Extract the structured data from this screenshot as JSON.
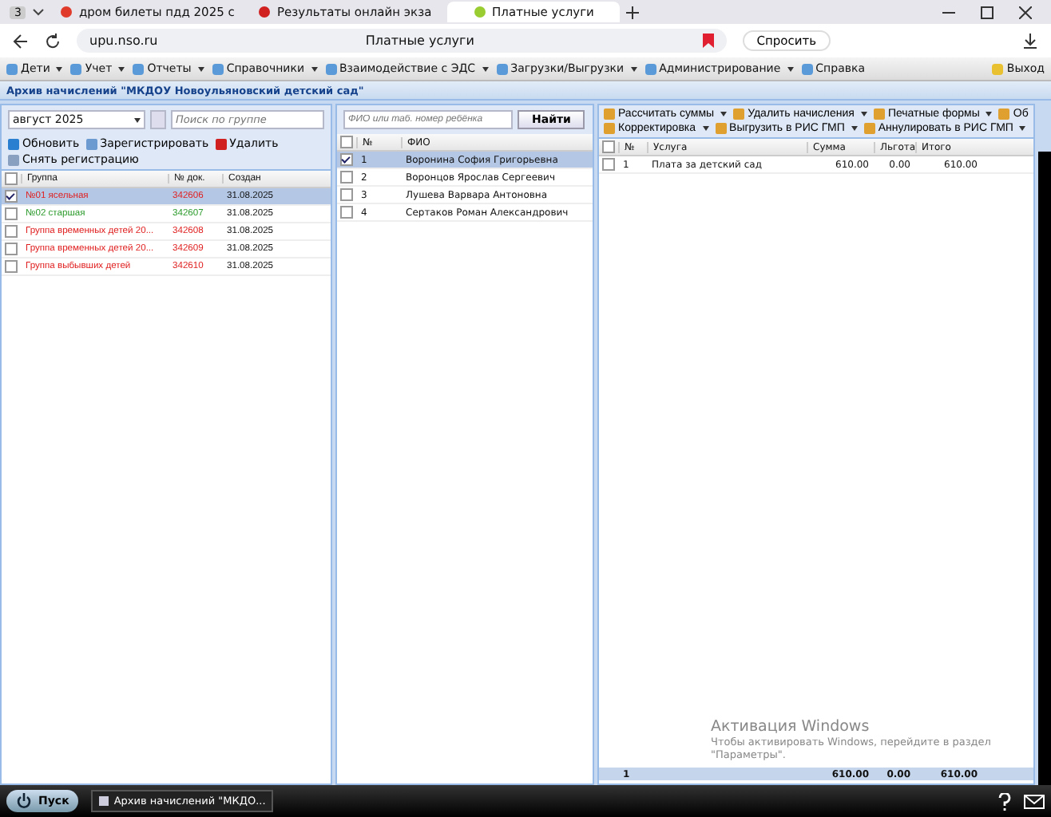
{
  "browser": {
    "tab_count": "3",
    "tabs": [
      {
        "label": "дром билеты пдд 2025 с",
        "selected": false
      },
      {
        "label": "Результаты онлайн экза",
        "selected": false
      },
      {
        "label": "Платные услуги",
        "selected": true
      }
    ],
    "address": "upu.nso.ru",
    "page_title": "Платные услуги",
    "ask_button": "Спросить"
  },
  "menu": {
    "items": [
      {
        "label": "Дети",
        "dropdown": true
      },
      {
        "label": "Учет",
        "dropdown": true
      },
      {
        "label": "Отчеты",
        "dropdown": true
      },
      {
        "label": "Справочники",
        "dropdown": true
      },
      {
        "label": "Взаимодействие с ЭДС",
        "dropdown": true
      },
      {
        "label": "Загрузки/Выгрузки",
        "dropdown": true
      },
      {
        "label": "Администрирование",
        "dropdown": true
      },
      {
        "label": "Справка",
        "dropdown": false
      }
    ],
    "exit": "Выход"
  },
  "window": {
    "title": "Архив начислений \"МКДОУ Новоульяновский детский сад\""
  },
  "groups_panel": {
    "period": "август 2025",
    "search": {
      "placeholder": "Поиск по группе"
    },
    "toolbar": [
      {
        "label": "Обновить",
        "kind": "refresh"
      },
      {
        "label": "Зарегистрировать",
        "kind": "register"
      },
      {
        "label": "Удалить",
        "kind": "delete"
      },
      {
        "label": "Снять регистрацию",
        "kind": "unregister"
      }
    ],
    "header_checked": false,
    "columns": [
      "Группа",
      "№ док.",
      "Создан"
    ],
    "rows": [
      {
        "name": "№01 ясельная",
        "doc": "342606",
        "created": "31.08.2025",
        "color": "#e02020",
        "checked": true,
        "selected": true
      },
      {
        "name": "№02 старшая",
        "doc": "342607",
        "created": "31.08.2025",
        "color": "#2a9a2a",
        "checked": false,
        "selected": false
      },
      {
        "name": "Группа временных детей 20...",
        "doc": "342608",
        "created": "31.08.2025",
        "color": "#e02020",
        "checked": false,
        "selected": false
      },
      {
        "name": "Группа временных детей 20...",
        "doc": "342609",
        "created": "31.08.2025",
        "color": "#e02020",
        "checked": false,
        "selected": false
      },
      {
        "name": "Группа выбывших детей",
        "doc": "342610",
        "created": "31.08.2025",
        "color": "#e02020",
        "checked": false,
        "selected": false
      }
    ]
  },
  "children_panel": {
    "search": {
      "placeholder": "ФИО или таб. номер ребёнка"
    },
    "find_button": "Найти",
    "header_checked": false,
    "columns": [
      "№",
      "ФИО"
    ],
    "rows": [
      {
        "num": "1",
        "name": "Воронина София Григорьевна",
        "checked": true,
        "selected": true
      },
      {
        "num": "2",
        "name": "Воронцов Ярослав Сергеевич",
        "checked": false,
        "selected": false
      },
      {
        "num": "3",
        "name": "Лушева Варвара Антоновна",
        "checked": false,
        "selected": false
      },
      {
        "num": "4",
        "name": "Сертаков Роман Александрович",
        "checked": false,
        "selected": false
      }
    ]
  },
  "services_panel": {
    "toolbar_rows": [
      [
        {
          "label": "Рассчитать суммы",
          "dropdown": true
        },
        {
          "label": "Удалить начисления",
          "dropdown": true
        },
        {
          "label": "Печатные формы",
          "dropdown": true
        },
        {
          "label": "Об",
          "dropdown": false
        }
      ],
      [
        {
          "label": "Корректировка",
          "dropdown": true
        },
        {
          "label": "Выгрузить в РИС ГМП",
          "dropdown": true
        },
        {
          "label": "Аннулировать в РИС ГМП",
          "dropdown": true
        }
      ]
    ],
    "header_checked": false,
    "columns": [
      "№",
      "Услуга",
      "Сумма",
      "Льгота",
      "Итого"
    ],
    "rows": [
      {
        "num": "1",
        "service": "Плата за детский сад",
        "sum": "610.00",
        "benefit": "0.00",
        "total": "610.00",
        "checked": false
      }
    ],
    "totals": {
      "count": "1",
      "sum": "610.00",
      "benefit": "0.00",
      "total": "610.00"
    }
  },
  "windows_notice": {
    "title": "Активация Windows",
    "text": "Чтобы активировать Windows, перейдите в раздел \"Параметры\"."
  },
  "taskbar": {
    "start": "Пуск",
    "task": "Архив начислений \"МКДО..."
  }
}
